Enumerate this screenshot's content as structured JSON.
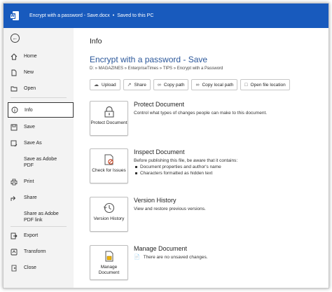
{
  "titlebar": {
    "filename": "Encrypt with a password - Save.docx",
    "separator": "•",
    "save_status": "Saved to this PC"
  },
  "sidebar": {
    "items": [
      {
        "label": "Home",
        "icon": "home-icon"
      },
      {
        "label": "New",
        "icon": "new-document-icon"
      },
      {
        "label": "Open",
        "icon": "folder-open-icon"
      },
      {
        "label": "Info",
        "icon": "info-icon"
      },
      {
        "label": "Save",
        "icon": "save-icon"
      },
      {
        "label": "Save As",
        "icon": "save-as-icon"
      },
      {
        "label": "Save as Adobe PDF",
        "icon": ""
      },
      {
        "label": "Print",
        "icon": "print-icon"
      },
      {
        "label": "Share",
        "icon": "share-icon"
      },
      {
        "label": "Share as Adobe PDF link",
        "icon": ""
      },
      {
        "label": "Export",
        "icon": "export-icon"
      },
      {
        "label": "Transform",
        "icon": "transform-icon"
      },
      {
        "label": "Close",
        "icon": "close-icon"
      }
    ],
    "active": "Info"
  },
  "main": {
    "heading": "Info",
    "document_title": "Encrypt with a password - Save",
    "path": "D: » MAGAZINES » EnterpriseTimes » TIPS » Encrypt with a Password",
    "toolbar": {
      "upload": "Upload",
      "share": "Share",
      "copy_path": "Copy path",
      "copy_local_path": "Copy local path",
      "open_file_location": "Open file location"
    },
    "protect": {
      "button_label": "Protect Document",
      "title": "Protect Document",
      "description": "Control what types of changes people can make to this document."
    },
    "inspect": {
      "button_label": "Check for Issues",
      "title": "Inspect Document",
      "description": "Before publishing this file, be aware that it contains:",
      "bullets": [
        "Document properties and author's name",
        "Characters formatted as hidden text"
      ]
    },
    "version": {
      "button_label": "Version History",
      "title": "Version History",
      "description": "View and restore previous versions."
    },
    "manage": {
      "button_label": "Manage Document",
      "title": "Manage Document",
      "status": "There are no unsaved changes."
    }
  },
  "colors": {
    "titlebar": "#185abd",
    "title_text": "#2b579a",
    "sidebar_bg": "#f3f3f3"
  }
}
